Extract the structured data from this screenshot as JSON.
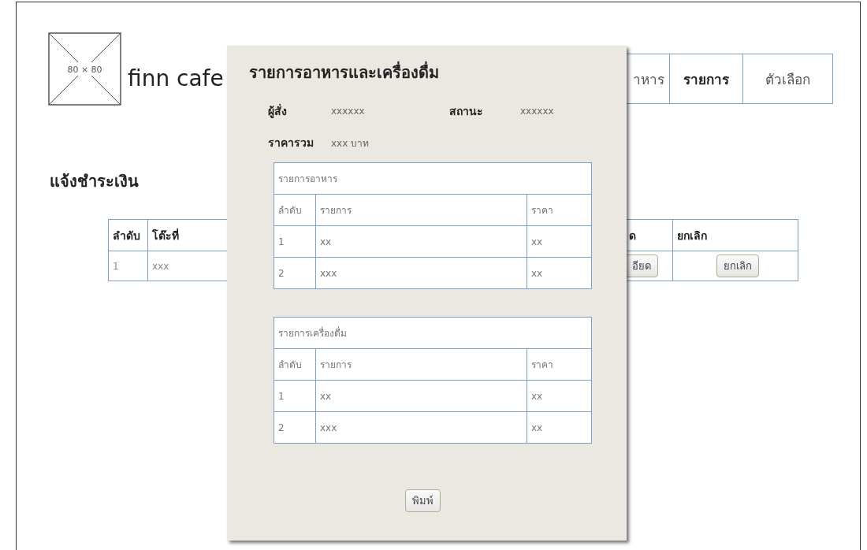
{
  "logo": {
    "label": "80 × 80"
  },
  "brand": "finn cafe",
  "nav": [
    {
      "label": "าหาร",
      "selected": false
    },
    {
      "label": "รายการ",
      "selected": true
    },
    {
      "label": "ตัวเลือก",
      "selected": false
    }
  ],
  "heading": "แจ้งชำระเงิน",
  "orders_table": {
    "columns": [
      "ลำดับ",
      "โต๊ะที่",
      "ด",
      "ยกเลิก"
    ],
    "rows": [
      {
        "cells": [
          "1",
          "xxx"
        ],
        "detail_button": "อียด",
        "cancel_button": "ยกเลิก"
      }
    ]
  },
  "dialog": {
    "title": "รายการอาหารและเครื่องดื่ม",
    "fields": [
      {
        "label": "ผู้สั่ง",
        "value": "xxxxxx"
      },
      {
        "label": "สถานะ",
        "value": "xxxxxx"
      },
      {
        "label": "ราคารวม",
        "value": "xxx บาท"
      }
    ],
    "tables": [
      {
        "caption": "รายการอาหาร",
        "columns": [
          "ลำดับ",
          "รายการ",
          "ราคา"
        ],
        "rows": [
          [
            "1",
            "xx",
            "xx"
          ],
          [
            "2",
            "xxx",
            "xx"
          ]
        ]
      },
      {
        "caption": "รายการเครื่องดื่ม",
        "columns": [
          "ลำดับ",
          "รายการ",
          "ราคา"
        ],
        "rows": [
          [
            "1",
            "xx",
            "xx"
          ],
          [
            "2",
            "xxx",
            "xx"
          ]
        ]
      }
    ],
    "print_button": "พิมพ์"
  }
}
